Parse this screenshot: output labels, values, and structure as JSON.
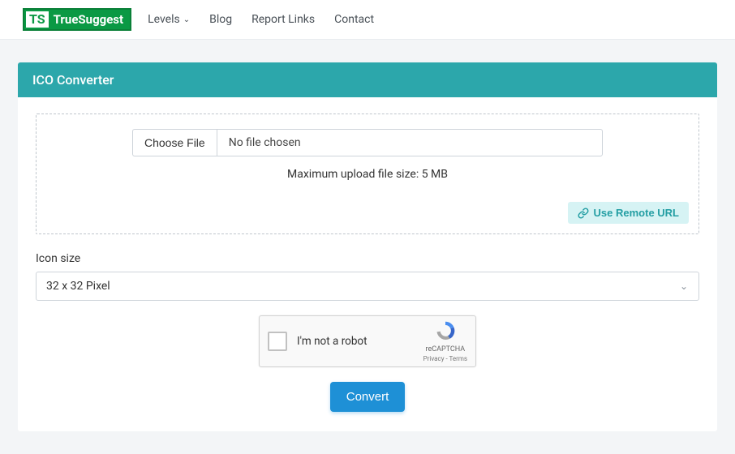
{
  "brand": {
    "short": "TS",
    "name": "TrueSuggest"
  },
  "nav": {
    "levels": "Levels",
    "blog": "Blog",
    "report_links": "Report Links",
    "contact": "Contact"
  },
  "card": {
    "title": "ICO Converter"
  },
  "upload": {
    "choose_file": "Choose File",
    "no_file": "No file chosen",
    "max_size": "Maximum upload file size: 5 MB",
    "remote_url": "Use Remote URL"
  },
  "icon_size": {
    "label": "Icon size",
    "selected": "32 x 32 Pixel"
  },
  "captcha": {
    "text": "I'm not a robot",
    "brand": "reCAPTCHA",
    "links": "Privacy - Terms"
  },
  "actions": {
    "convert": "Convert"
  }
}
